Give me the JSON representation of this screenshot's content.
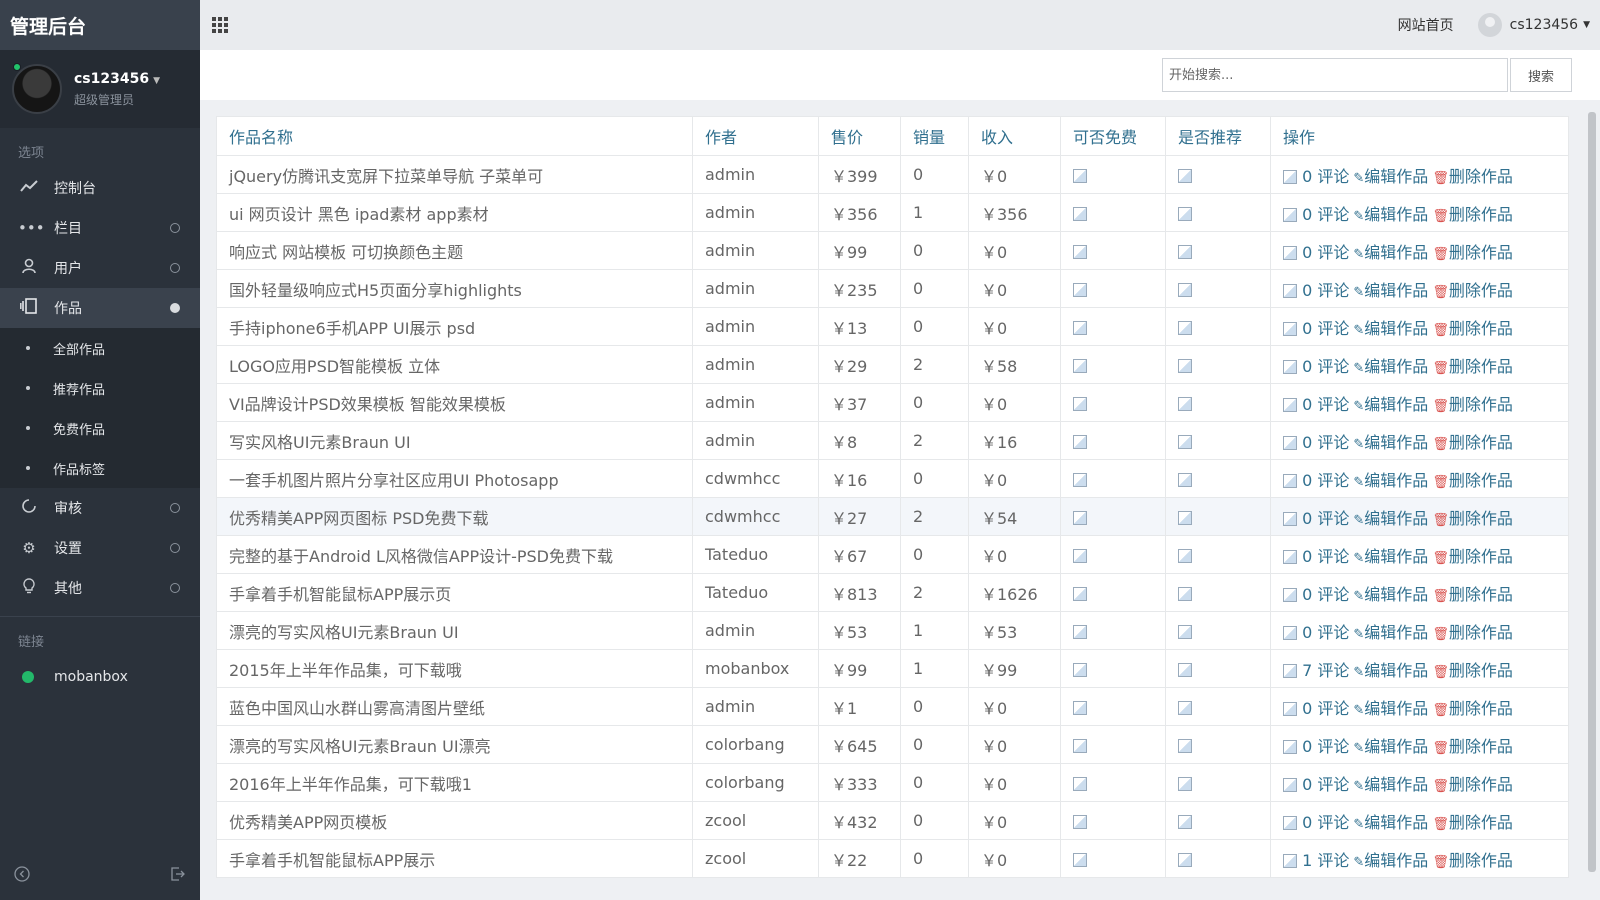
{
  "app": {
    "title": "管理后台"
  },
  "user": {
    "name": "cs123456",
    "role": "超级管理员"
  },
  "sidebar": {
    "section_options": "选项",
    "items": [
      {
        "label": "控制台",
        "icon": "trend-line-icon"
      },
      {
        "label": "栏目",
        "icon": "dots-icon"
      },
      {
        "label": "用户",
        "icon": "user-icon"
      },
      {
        "label": "作品",
        "icon": "works-icon"
      }
    ],
    "sub_items": [
      {
        "label": "全部作品"
      },
      {
        "label": "推荐作品"
      },
      {
        "label": "免费作品"
      },
      {
        "label": "作品标签"
      }
    ],
    "items2": [
      {
        "label": "审核",
        "icon": "refresh-icon"
      },
      {
        "label": "设置",
        "icon": "gear-icon"
      },
      {
        "label": "其他",
        "icon": "bulb-icon"
      }
    ],
    "section_links": "链接",
    "links": [
      {
        "label": "mobanbox"
      }
    ]
  },
  "topbar": {
    "site_home": "网站首页",
    "username": "cs123456"
  },
  "search": {
    "placeholder": "开始搜索...",
    "button": "搜索"
  },
  "table": {
    "headers": [
      "作品名称",
      "作者",
      "售价",
      "销量",
      "收入",
      "可否免费",
      "是否推荐",
      "操作"
    ],
    "comment_label": "评论",
    "edit_label": "编辑作品",
    "delete_label": "删除作品",
    "rows": [
      {
        "name": "jQuery仿腾讯支宽屏下拉菜单导航 子菜单可",
        "author": "admin",
        "price": "￥399",
        "sales": "0",
        "income": "￥0",
        "comments": "0"
      },
      {
        "name": "ui 网页设计 黑色 ipad素材 app素材",
        "author": "admin",
        "price": "￥356",
        "sales": "1",
        "income": "￥356",
        "comments": "0"
      },
      {
        "name": "响应式 网站模板 可切换颜色主题",
        "author": "admin",
        "price": "￥99",
        "sales": "0",
        "income": "￥0",
        "comments": "0"
      },
      {
        "name": "国外轻量级响应式H5页面分享highlights",
        "author": "admin",
        "price": "￥235",
        "sales": "0",
        "income": "￥0",
        "comments": "0"
      },
      {
        "name": "手持iphone6手机APP UI展示 psd",
        "author": "admin",
        "price": "￥13",
        "sales": "0",
        "income": "￥0",
        "comments": "0"
      },
      {
        "name": "LOGO应用PSD智能模板 立体",
        "author": "admin",
        "price": "￥29",
        "sales": "2",
        "income": "￥58",
        "comments": "0"
      },
      {
        "name": "VI品牌设计PSD效果模板 智能效果模板",
        "author": "admin",
        "price": "￥37",
        "sales": "0",
        "income": "￥0",
        "comments": "0"
      },
      {
        "name": "写实风格UI元素Braun UI",
        "author": "admin",
        "price": "￥8",
        "sales": "2",
        "income": "￥16",
        "comments": "0"
      },
      {
        "name": "一套手机图片照片分享社区应用UI Photosapp",
        "author": "cdwmhcc",
        "price": "￥16",
        "sales": "0",
        "income": "￥0",
        "comments": "0"
      },
      {
        "name": "优秀精美APP网页图标 PSD免费下载",
        "author": "cdwmhcc",
        "price": "￥27",
        "sales": "2",
        "income": "￥54",
        "comments": "0"
      },
      {
        "name": "完整的基于Android L风格微信APP设计-PSD免费下载",
        "author": "Tateduo",
        "price": "￥67",
        "sales": "0",
        "income": "￥0",
        "comments": "0"
      },
      {
        "name": "手拿着手机智能鼠标APP展示页",
        "author": "Tateduo",
        "price": "￥813",
        "sales": "2",
        "income": "￥1626",
        "comments": "0"
      },
      {
        "name": "漂亮的写实风格UI元素Braun UI",
        "author": "admin",
        "price": "￥53",
        "sales": "1",
        "income": "￥53",
        "comments": "0"
      },
      {
        "name": "2015年上半年作品集，可下载哦",
        "author": "mobanbox",
        "price": "￥99",
        "sales": "1",
        "income": "￥99",
        "comments": "7"
      },
      {
        "name": "蓝色中国风山水群山雾高清图片壁纸",
        "author": "admin",
        "price": "￥1",
        "sales": "0",
        "income": "￥0",
        "comments": "0"
      },
      {
        "name": "漂亮的写实风格UI元素Braun UI漂亮",
        "author": "colorbang",
        "price": "￥645",
        "sales": "0",
        "income": "￥0",
        "comments": "0"
      },
      {
        "name": "2016年上半年作品集，可下载哦1",
        "author": "colorbang",
        "price": "￥333",
        "sales": "0",
        "income": "￥0",
        "comments": "0"
      },
      {
        "name": "优秀精美APP网页模板",
        "author": "zcool",
        "price": "￥432",
        "sales": "0",
        "income": "￥0",
        "comments": "0"
      },
      {
        "name": "手拿着手机智能鼠标APP展示",
        "author": "zcool",
        "price": "￥22",
        "sales": "0",
        "income": "￥0",
        "comments": "1"
      }
    ]
  }
}
